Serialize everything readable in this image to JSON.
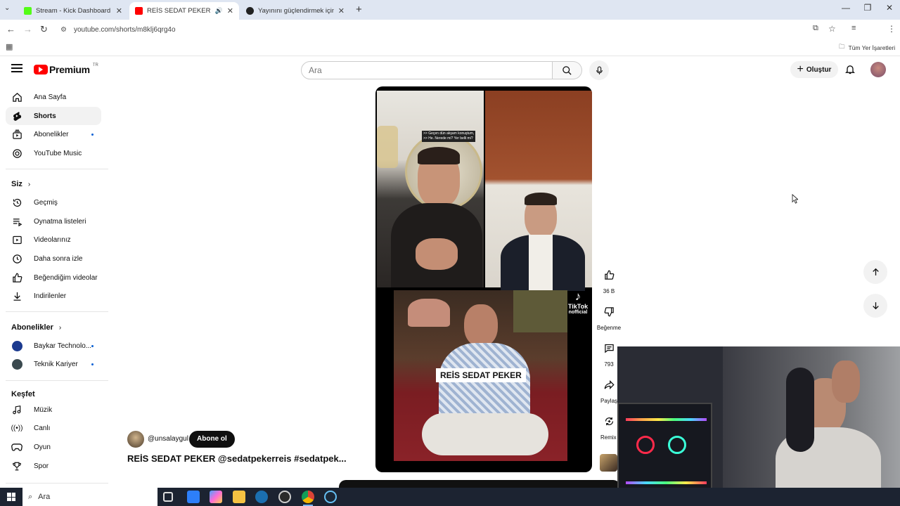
{
  "browser": {
    "tabs": [
      {
        "title": "Stream - Kick Dashboard",
        "color": "#53fc18"
      },
      {
        "title": "REİS SEDAT PEKER @sedatp",
        "color": "#ff0000"
      },
      {
        "title": "Yayınını güçlendirmek için en iyi",
        "color": "#222222"
      }
    ],
    "url": "youtube.com/shorts/m8klj6qrg4o",
    "bookmarks_label": "Tüm Yer İşaretleri"
  },
  "header": {
    "logo_text": "Premium",
    "logo_region": "TR",
    "search_placeholder": "Ara",
    "create_label": "Oluştur"
  },
  "sidebar": {
    "main": [
      {
        "label": "Ana Sayfa",
        "icon": "home-icon"
      },
      {
        "label": "Shorts",
        "icon": "shorts-icon",
        "selected": true
      },
      {
        "label": "Abonelikler",
        "icon": "subscriptions-icon",
        "dot": true
      },
      {
        "label": "YouTube Music",
        "icon": "music-icon"
      }
    ],
    "you_title": "Siz",
    "you": [
      {
        "label": "Geçmiş",
        "icon": "history-icon"
      },
      {
        "label": "Oynatma listeleri",
        "icon": "playlists-icon"
      },
      {
        "label": "Videolarınız",
        "icon": "your-videos-icon"
      },
      {
        "label": "Daha sonra izle",
        "icon": "watch-later-icon"
      },
      {
        "label": "Beğendiğim videolar",
        "icon": "liked-icon"
      },
      {
        "label": "İndirilenler",
        "icon": "download-icon"
      }
    ],
    "subs_title": "Abonelikler",
    "subs": [
      {
        "label": "Baykar Technolo...",
        "dot": true
      },
      {
        "label": "Teknik Kariyer",
        "dot": true
      }
    ],
    "explore_title": "Keşfet",
    "explore": [
      {
        "label": "Müzik",
        "icon": "music-note-icon"
      },
      {
        "label": "Canlı",
        "icon": "live-icon"
      },
      {
        "label": "Oyun",
        "icon": "gaming-icon"
      },
      {
        "label": "Spor",
        "icon": "trophy-icon"
      }
    ]
  },
  "short": {
    "channel": "@unsalaygul",
    "subscribe_label": "Abone ol",
    "title": "REİS SEDAT PEKER @sedatpekerreis #sedatpek...",
    "overlay_caption": "REİS SEDAT PEKER",
    "tiktok_label": "TikTok",
    "tiktok_handle": "nofficial",
    "text_overlay_1": ">> Geçen dün akşam konuştum,",
    "text_overlay_2": ">> He. Nerede mi? Yer belli mi?",
    "likes": "36 B",
    "dislike_label": "Beğenme",
    "comments": "793",
    "share_label": "Paylaş",
    "remix_label": "Remix"
  },
  "taskbar": {
    "search_placeholder": "Ara"
  }
}
